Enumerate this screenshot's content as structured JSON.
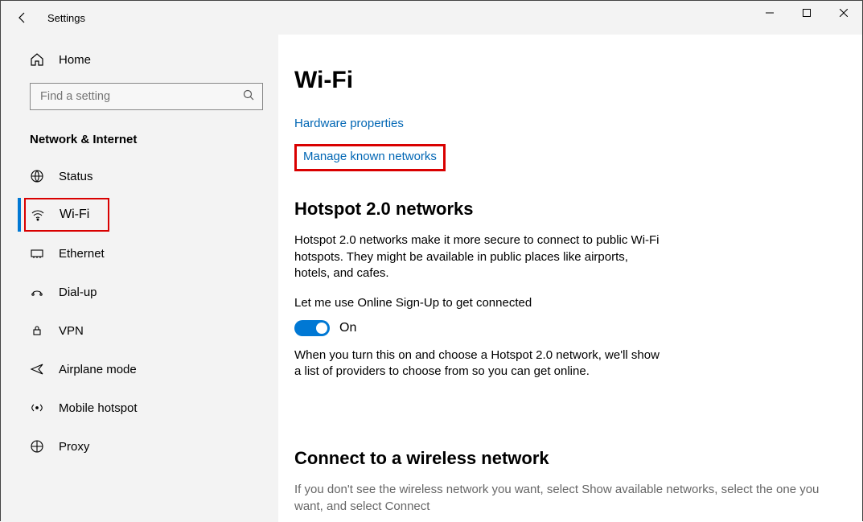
{
  "window": {
    "title": "Settings"
  },
  "sidebar": {
    "home_label": "Home",
    "search_placeholder": "Find a setting",
    "category": "Network & Internet",
    "items": [
      {
        "label": "Status",
        "icon": "status"
      },
      {
        "label": "Wi-Fi",
        "icon": "wifi",
        "selected": true,
        "highlighted": true
      },
      {
        "label": "Ethernet",
        "icon": "ethernet"
      },
      {
        "label": "Dial-up",
        "icon": "dialup"
      },
      {
        "label": "VPN",
        "icon": "vpn"
      },
      {
        "label": "Airplane mode",
        "icon": "airplane"
      },
      {
        "label": "Mobile hotspot",
        "icon": "hotspot"
      },
      {
        "label": "Proxy",
        "icon": "proxy"
      }
    ]
  },
  "main": {
    "title": "Wi-Fi",
    "links": {
      "hardware": "Hardware properties",
      "manage": "Manage known networks"
    },
    "hotspot": {
      "heading": "Hotspot 2.0 networks",
      "desc": "Hotspot 2.0 networks make it more secure to connect to public Wi-Fi hotspots. They might be available in public places like airports, hotels, and cafes.",
      "toggle_label": "Let me use Online Sign-Up to get connected",
      "toggle_state": "On",
      "note": "When you turn this on and choose a Hotspot 2.0 network, we'll show a list of providers to choose from so you can get online."
    },
    "connect": {
      "heading": "Connect to a wireless network",
      "desc": "If you don't see the wireless network you want, select Show available networks, select the one you want, and select Connect"
    }
  }
}
